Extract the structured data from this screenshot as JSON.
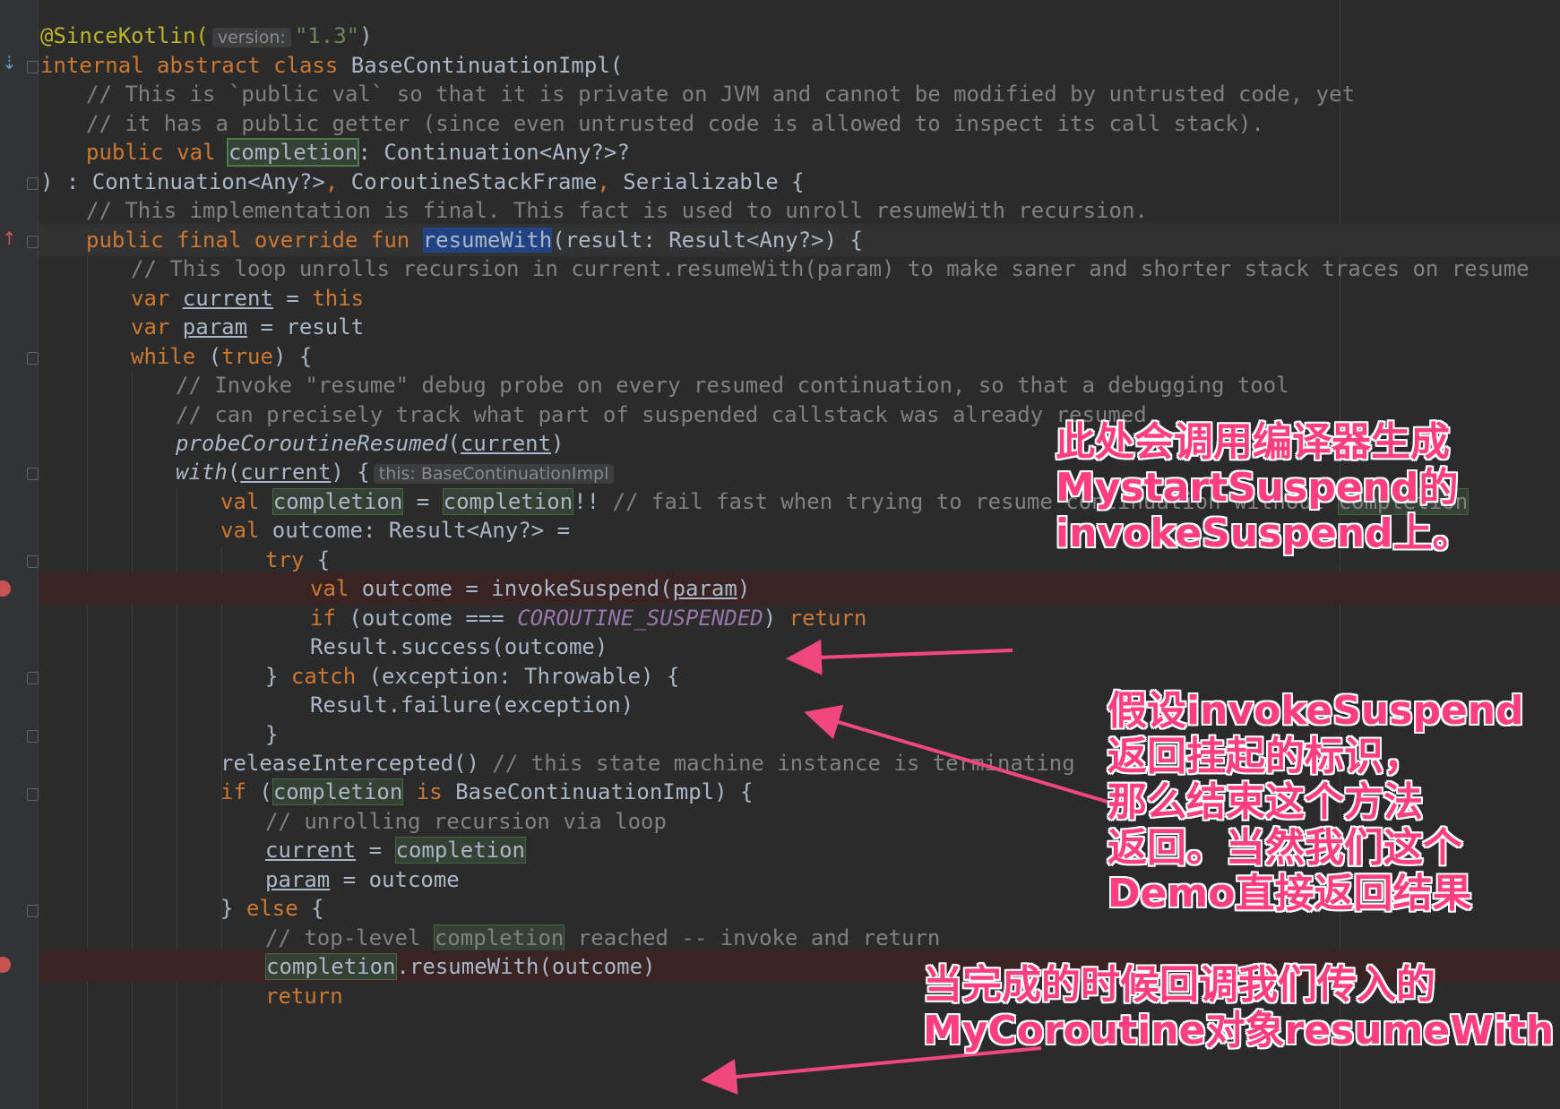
{
  "code": {
    "l1": {
      "ann": "@SinceKotlin(",
      "hint": "version:",
      "str": "\"1.3\"",
      "close": ")"
    },
    "l2": {
      "kw": "internal abstract class ",
      "rest": "BaseContinuationImpl("
    },
    "l3": {
      "cmt": "// This is `public val` so that it is private on JVM and cannot be modified by untrusted code, yet"
    },
    "l4": {
      "cmt": "// it has a public getter (since even untrusted code is allowed to inspect its call stack)."
    },
    "l5": {
      "kw": "public val ",
      "var": "completion",
      "rest": ": Continuation<Any?>?"
    },
    "l6": {
      "a": ") : Continuation<Any?>",
      "comma1": ", ",
      "b": "CoroutineStackFrame",
      "comma2": ", ",
      "c": "Serializable {"
    },
    "l7": {
      "cmt": "// This implementation is final. This fact is used to unroll resumeWith recursion."
    },
    "l8": {
      "kw": "public final override fun ",
      "fn": "resumeWith",
      "rest": "(result: Result<Any?>) {"
    },
    "l9": {
      "cmt": "// This loop unrolls recursion in current.resumeWith(param) to make saner and shorter stack traces on resume"
    },
    "l10": {
      "kw": "var ",
      "var": "current",
      "eq": " = ",
      "kw2": "this"
    },
    "l11": {
      "kw": "var ",
      "var": "param",
      "rest": " = result"
    },
    "l12": {
      "kw": "while ",
      "p1": "(",
      "kw2": "true",
      "p2": ") {"
    },
    "l13": {
      "cmt": "// Invoke \"resume\" debug probe on every resumed continuation, so that a debugging tool"
    },
    "l14": {
      "cmt": "// can precisely track what part of suspended callstack was already resumed"
    },
    "l15": {
      "fn": "probeCoroutineResumed",
      "p1": "(",
      "var": "current",
      "p2": ")"
    },
    "l16": {
      "fn": "with",
      "p1": "(",
      "var": "current",
      "p2": ") {",
      "hint": "this: BaseContinuationImpl"
    },
    "l17": {
      "kw": "val ",
      "var": "completion",
      "eq": " = ",
      "var2": "completion",
      "rest": "!! ",
      "cmt": "// fail fast when trying to resume continuation without ",
      "var3": "completion"
    },
    "l18": {
      "kw": "val ",
      "rest": "outcome: Result<Any?> ="
    },
    "l19": {
      "kw": "try ",
      "rest": "{"
    },
    "l20": {
      "kw": "val ",
      "rest": "outcome = invokeSuspend(",
      "var": "param",
      "p2": ")"
    },
    "l21": {
      "kw": "if ",
      "rest": "(outcome === ",
      "const": "COROUTINE_SUSPENDED",
      "p2": ") ",
      "kw2": "return"
    },
    "l22": {
      "rest": "Result.success(outcome)"
    },
    "l23": {
      "p1": "} ",
      "kw": "catch ",
      "rest": "(exception: Throwable) {"
    },
    "l24": {
      "rest": "Result.failure(exception)"
    },
    "l25": {
      "rest": "}"
    },
    "l26": {
      "rest": "releaseIntercepted() ",
      "cmt": "// this state machine instance is terminating"
    },
    "l27": {
      "kw": "if ",
      "p1": "(",
      "var": "completion",
      "kw2": " is ",
      "rest": "BaseContinuationImpl) {"
    },
    "l28": {
      "cmt": "// unrolling recursion via loop"
    },
    "l29": {
      "var": "current",
      "eq": " = ",
      "var2": "completion"
    },
    "l30": {
      "var": "param",
      "rest": " = outcome"
    },
    "l31": {
      "p1": "} ",
      "kw": "else ",
      "rest": "{"
    },
    "l32": {
      "cmt": "// top-level ",
      "var": "completion",
      "cmt2": " reached -- invoke and return"
    },
    "l33": {
      "var": "completion",
      "rest": ".resumeWith(outcome)"
    },
    "l34": {
      "kw": "return"
    }
  },
  "annotations": {
    "note1": "此处会调用编译器生成\nMystartSuspend的\ninvokeSuspend上。",
    "note2": "假设invokeSuspend\n返回挂起的标识，\n那么结束这个方法\n返回。当然我们这个\nDemo直接返回结果",
    "note3": "当完成的时候回调我们传入的\nMyCoroutine对象resumeWith"
  },
  "colors": {
    "background": "#2b2b2b",
    "keyword": "#cc7832",
    "comment": "#808080",
    "string": "#6a8759",
    "annotation_text": "#ff3d7f",
    "arrow": "#f0487e"
  }
}
